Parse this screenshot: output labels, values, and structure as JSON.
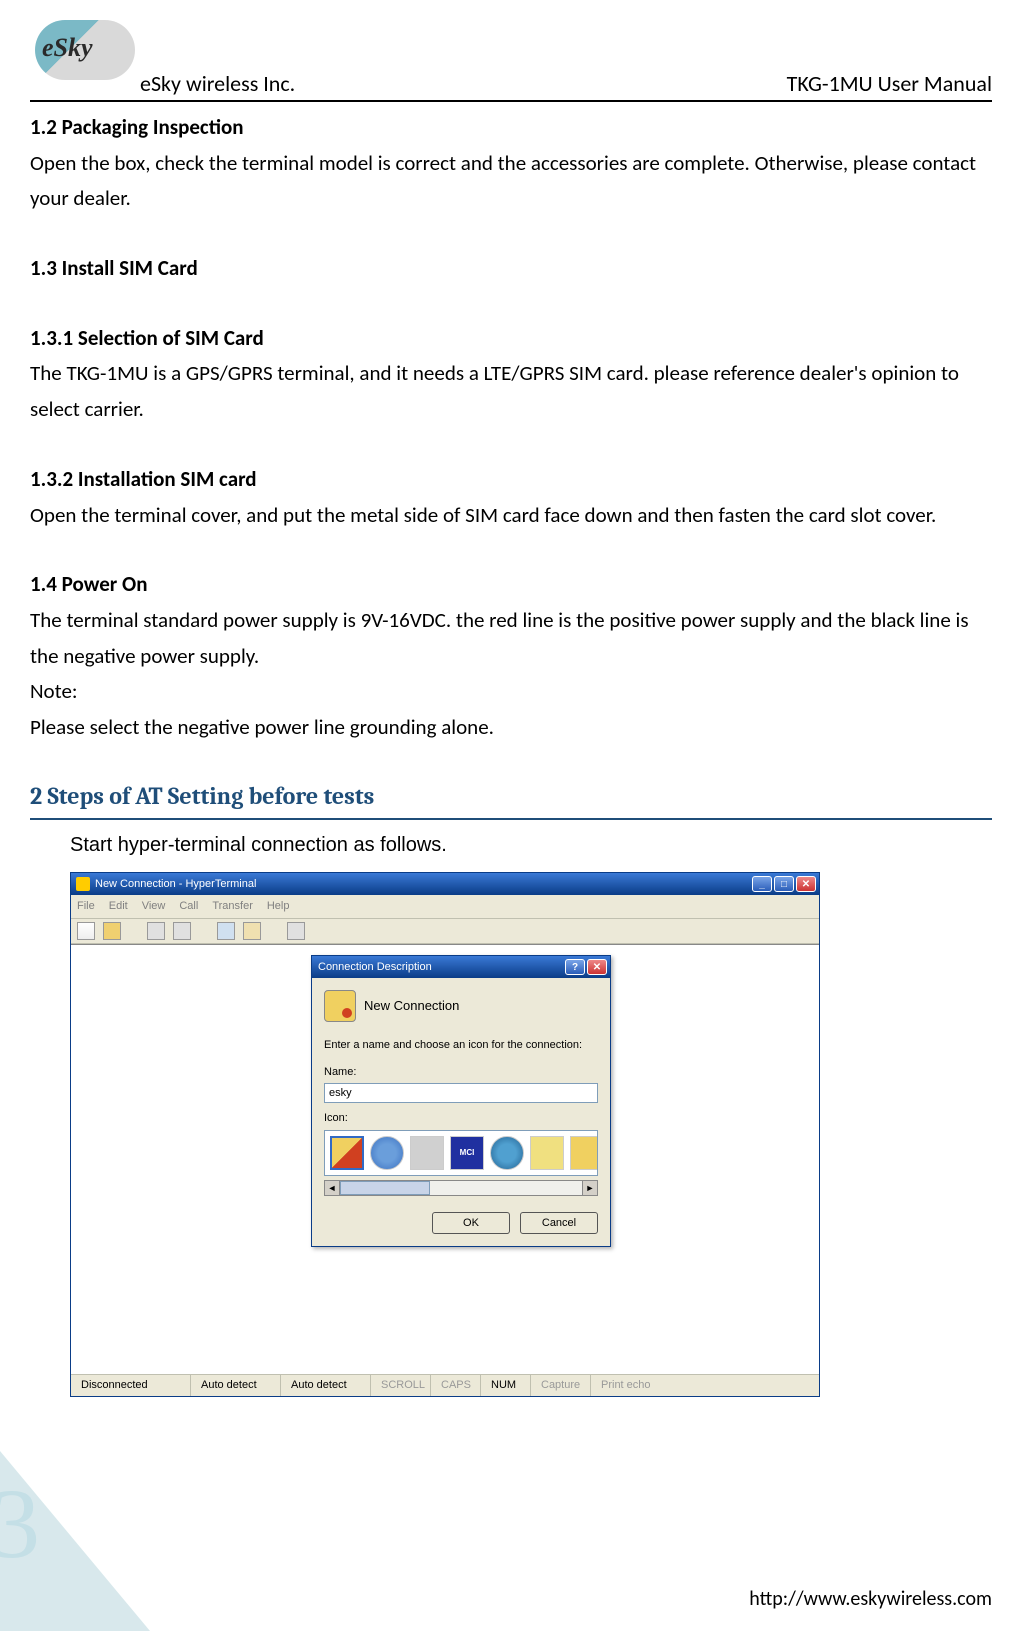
{
  "header": {
    "company": "eSky wireless Inc.",
    "doc_title": "TKG-1MU User Manual",
    "logo_text": "eSky"
  },
  "sections": {
    "s12_title": "1.2  Packaging Inspection",
    "s12_body": "Open the box, check the terminal model is correct and the accessories are complete. Otherwise, please contact your dealer.",
    "s13_title": "1.3  Install SIM Card",
    "s131_title": "1.3.1      Selection of SIM Card",
    "s131_body": "The TKG-1MU is a GPS/GPRS terminal, and it needs a LTE/GPRS SIM card. please reference dealer's opinion to select carrier.",
    "s132_title": "1.3.2      Installation SIM card",
    "s132_body": "Open the terminal cover, and put the metal side of SIM card face down and then fasten the card slot cover.",
    "s14_title": "1.4  Power On",
    "s14_body1": "The terminal standard power supply is 9V-16VDC. the red line is the positive power supply and the black line is the negative power supply.",
    "s14_note_label": "Note:",
    "s14_note_body": "Please select the negative power line grounding alone.",
    "chapter2_title": "2 Steps of AT Setting before tests",
    "chapter2_intro": "Start hyper-terminal connection as follows."
  },
  "hyperterminal": {
    "window_title": "New Connection - HyperTerminal",
    "menu": [
      "File",
      "Edit",
      "View",
      "Call",
      "Transfer",
      "Help"
    ],
    "dialog": {
      "title": "Connection Description",
      "heading": "New Connection",
      "prompt": "Enter a name and choose an icon for the connection:",
      "name_label": "Name:",
      "name_value": "esky",
      "icon_label": "Icon:",
      "icon_d_text": "MCI",
      "ok": "OK",
      "cancel": "Cancel"
    },
    "status": {
      "s1": "Disconnected",
      "s2": "Auto detect",
      "s3": "Auto detect",
      "s4": "SCROLL",
      "s5": "CAPS",
      "s6": "NUM",
      "s7": "Capture",
      "s8": "Print echo"
    }
  },
  "footer": {
    "page_number": "3",
    "url": "http://www.eskywireless.com"
  }
}
